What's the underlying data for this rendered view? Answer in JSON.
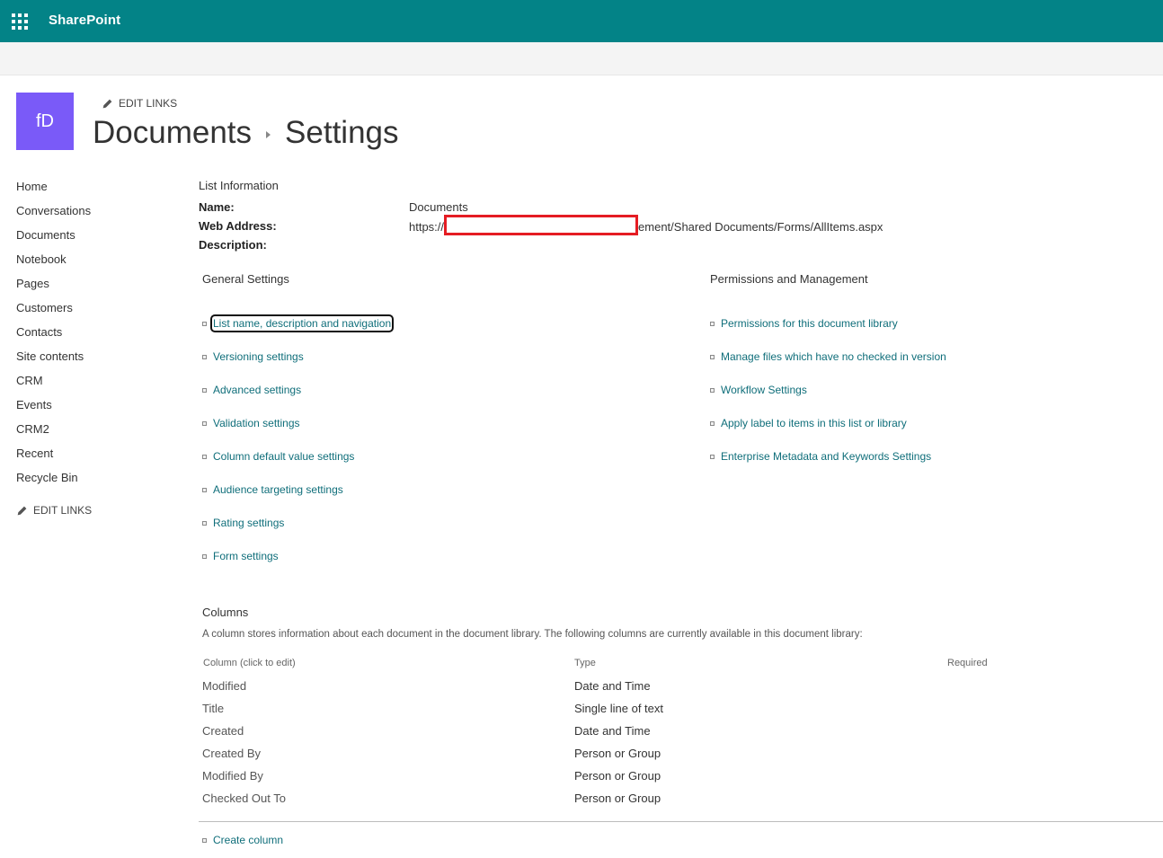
{
  "suite": {
    "brand": "SharePoint"
  },
  "site": {
    "logo_initials": "fD",
    "edit_links": "EDIT LINKS",
    "breadcrumb": [
      "Documents",
      "Settings"
    ]
  },
  "leftnav": {
    "items": [
      "Home",
      "Conversations",
      "Documents",
      "Notebook",
      "Pages",
      "Customers",
      "Contacts",
      "Site contents",
      "CRM",
      "Events",
      "CRM2",
      "Recent",
      "Recycle Bin"
    ],
    "edit_links": "EDIT LINKS"
  },
  "list_info": {
    "heading": "List Information",
    "name_label": "Name:",
    "name_value": "Documents",
    "web_label": "Web Address:",
    "web_prefix": "https://",
    "web_suffix": "ement/Shared Documents/Forms/AllItems.aspx",
    "desc_label": "Description:"
  },
  "general": {
    "heading": "General Settings",
    "links": [
      "List name, description and navigation",
      "Versioning settings",
      "Advanced settings",
      "Validation settings",
      "Column default value settings",
      "Audience targeting settings",
      "Rating settings",
      "Form settings"
    ]
  },
  "permissions": {
    "heading": "Permissions and Management",
    "links": [
      "Permissions for this document library",
      "Manage files which have no checked in version",
      "Workflow Settings",
      "Apply label to items in this list or library",
      "Enterprise Metadata and Keywords Settings"
    ]
  },
  "columns": {
    "heading": "Columns",
    "description": "A column stores information about each document in the document library. The following columns are currently available in this document library:",
    "headers": {
      "column": "Column (click to edit)",
      "type": "Type",
      "required": "Required"
    },
    "rows": [
      {
        "name": "Modified",
        "type": "Date and Time"
      },
      {
        "name": "Title",
        "type": "Single line of text"
      },
      {
        "name": "Created",
        "type": "Date and Time"
      },
      {
        "name": "Created By",
        "type": "Person or Group"
      },
      {
        "name": "Modified By",
        "type": "Person or Group"
      },
      {
        "name": "Checked Out To",
        "type": "Person or Group"
      }
    ],
    "create_column": "Create column"
  },
  "colors": {
    "suitebar": "#038387",
    "logo": "#7a5af8",
    "link": "#0f6e7a",
    "redaction": "#e51c23"
  }
}
